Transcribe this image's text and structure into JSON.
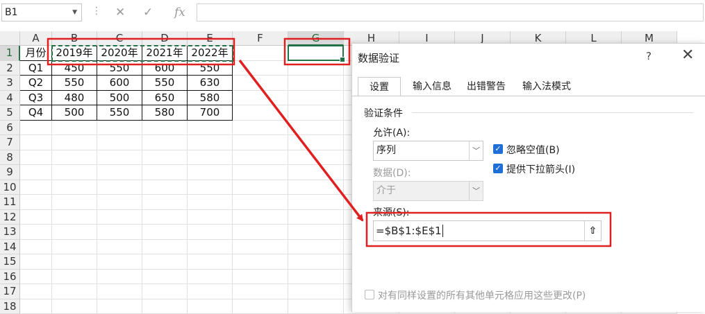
{
  "formula_bar": {
    "name_box": "B1",
    "fx": "fx",
    "formula_value": ""
  },
  "columns": [
    "A",
    "B",
    "C",
    "D",
    "E",
    "F",
    "G",
    "H",
    "I",
    "J",
    "K",
    "L",
    "M"
  ],
  "rows": [
    "1",
    "2",
    "3",
    "4",
    "5",
    "6",
    "7",
    "8",
    "9",
    "10",
    "11",
    "12",
    "13",
    "14",
    "15",
    "16",
    "17",
    "18"
  ],
  "table": [
    [
      "月份",
      "2019年",
      "2020年",
      "2021年",
      "2022年"
    ],
    [
      "Q1",
      "450",
      "550",
      "600",
      "550"
    ],
    [
      "Q2",
      "550",
      "600",
      "550",
      "630"
    ],
    [
      "Q3",
      "480",
      "500",
      "650",
      "580"
    ],
    [
      "Q4",
      "500",
      "550",
      "580",
      "700"
    ]
  ],
  "dialog": {
    "title": "数据验证",
    "help": "?",
    "close": "✕",
    "tabs": [
      "设置",
      "输入信息",
      "出错警告",
      "输入法模式"
    ],
    "section": "验证条件",
    "allow_label": "允许(A):",
    "allow_value": "序列",
    "data_label": "数据(D):",
    "data_value": "介于",
    "ignore_blank": "忽略空值(B)",
    "dropdown": "提供下拉箭头(I)",
    "source_label": "来源(S):",
    "source_value": "=$B$1:$E$1",
    "apply_all": "对有同样设置的所有其他单元格应用这些更改(P)"
  },
  "colors": {
    "annotation": "#e02020",
    "excel_green": "#217346",
    "checkbox_blue": "#1f6fd6"
  }
}
